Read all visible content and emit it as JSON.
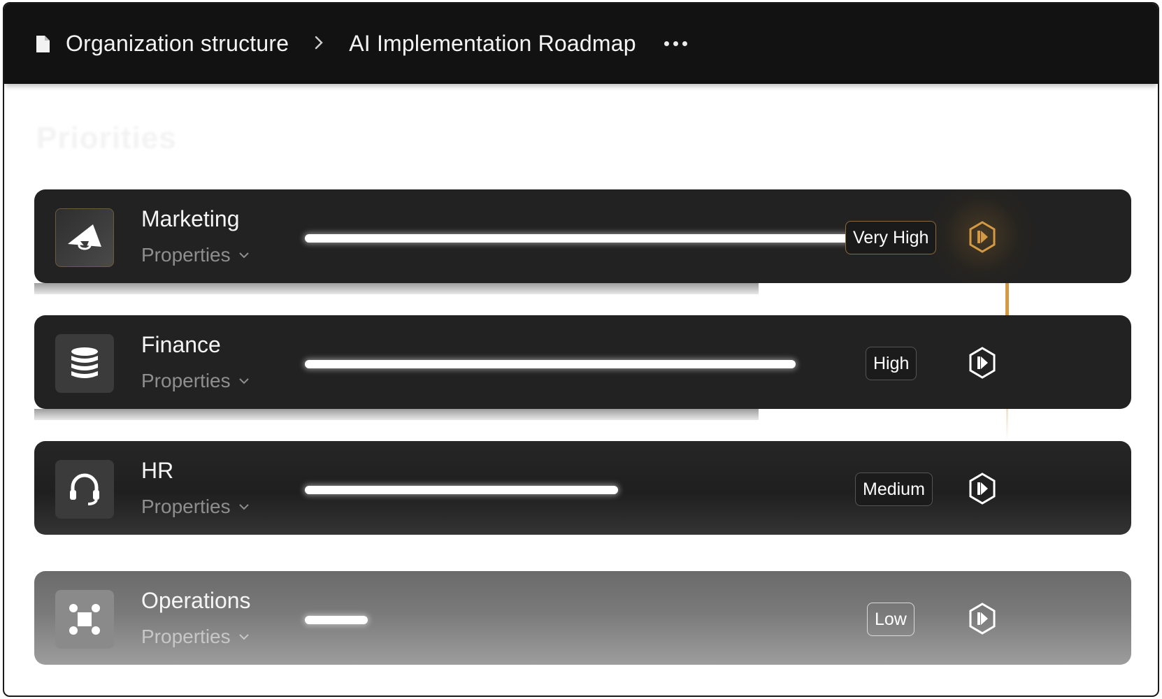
{
  "breadcrumb": {
    "root": "Organization structure",
    "current": "AI Implementation Roadmap"
  },
  "section": {
    "title": "Priorities"
  },
  "rows": [
    {
      "name": "Marketing",
      "properties_label": "Properties",
      "priority": "Very High",
      "progress": 0.74,
      "icon": "megaphone-icon",
      "accent": "#d49a43"
    },
    {
      "name": "Finance",
      "properties_label": "Properties",
      "priority": "High",
      "progress": 0.665,
      "icon": "coins-stack-icon",
      "accent": "#ffffff"
    },
    {
      "name": "HR",
      "properties_label": "Properties",
      "priority": "Medium",
      "progress": 0.425,
      "icon": "headset-icon",
      "accent": "#ffffff"
    },
    {
      "name": "Operations",
      "properties_label": "Properties",
      "priority": "Low",
      "progress": 0.085,
      "icon": "operations-nodes-icon",
      "accent": "#ffffff"
    }
  ]
}
